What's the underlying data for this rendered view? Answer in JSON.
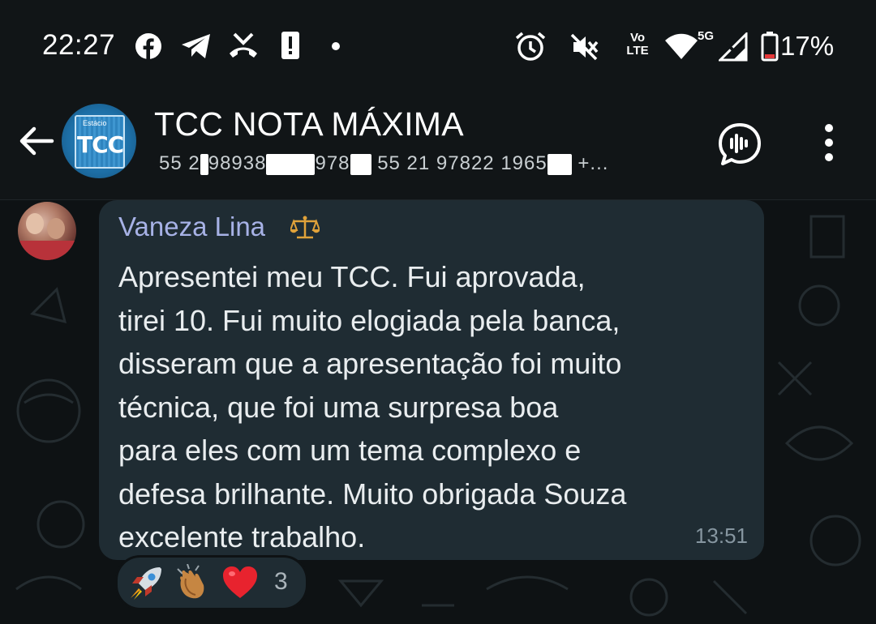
{
  "status_bar": {
    "time": "22:27",
    "battery_percent": "17%",
    "network_label": "5G",
    "volte_line1": "Vo",
    "volte_line2": "LTE",
    "icons": [
      "facebook-icon",
      "telegram-icon",
      "missed-call-icon",
      "alert-icon",
      "dot-icon",
      "alarm-icon",
      "mute-icon",
      "volte-icon",
      "wifi-icon",
      "signal-icon",
      "battery-icon"
    ]
  },
  "header": {
    "title": "TCC NOTA MÁXIMA",
    "avatar_small_text": "Estácio",
    "avatar_text": "TCC",
    "subtitle_parts": [
      "55 2",
      "98938",
      "978",
      "55 21 97822 1965",
      "+..."
    ]
  },
  "message": {
    "sender": "Vaneza Lina",
    "sender_emoji_icon": "scales-icon",
    "text": "Apresentei meu TCC. Fui aprovada,\ntirei 10. Fui muito elogiada pela banca,\ndisseram que a apresentação foi muito\ntécnica, que foi uma surpresa boa\npara eles com um tema complexo e\ndefesa brilhante. Muito obrigada Souza\nexcelente trabalho.",
    "time": "13:51"
  },
  "reactions": {
    "items": [
      "rocket-icon",
      "clapping-hands-icon",
      "heart-icon"
    ],
    "count": "3"
  },
  "colors": {
    "background": "#0e1214",
    "header": "#111517",
    "bubble": "#1f2c33",
    "sender_name": "#a7b2e6",
    "timestamp": "#8696a0"
  }
}
